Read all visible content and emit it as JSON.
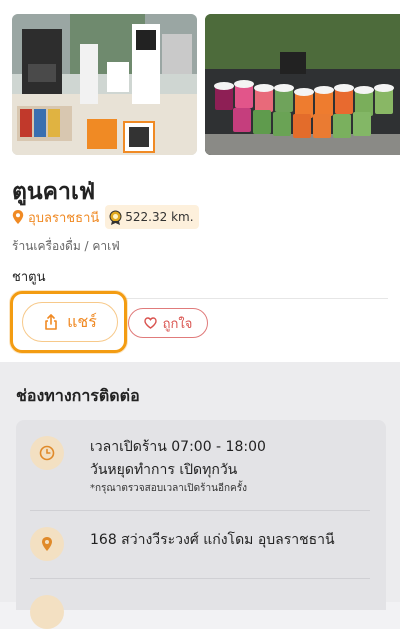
{
  "shop": {
    "name": "ตูนคาเฟ่",
    "province": "อุบลราชธานี",
    "distance": "522.32 km.",
    "category": "ร้านเครื่องดื่ม / คาเฟ่",
    "tag": "ชาตูน"
  },
  "actions": {
    "share_label": "แชร์",
    "like_label": "ถูกใจ"
  },
  "contact": {
    "title": "ช่องทางการติดต่อ",
    "hours_line": "เวลาเปิดร้าน 07:00 - 18:00",
    "holiday_line": "วันหยุดทำการ เปิดทุกวัน",
    "note": "*กรุณาตรวจสอบเวลาเปิดร้านอีกครั้ง",
    "address": "168 สว่างวีระวงศ์ แก่งโดม อุบลราชธานี"
  },
  "colors": {
    "accent": "#f08a24",
    "like": "#d9534f",
    "highlight": "#f39c12"
  },
  "icons": {
    "location": "map-pin-icon",
    "distance": "medal-icon",
    "share": "share-icon",
    "like": "heart-icon",
    "clock": "clock-icon",
    "address": "location-pin-icon"
  }
}
